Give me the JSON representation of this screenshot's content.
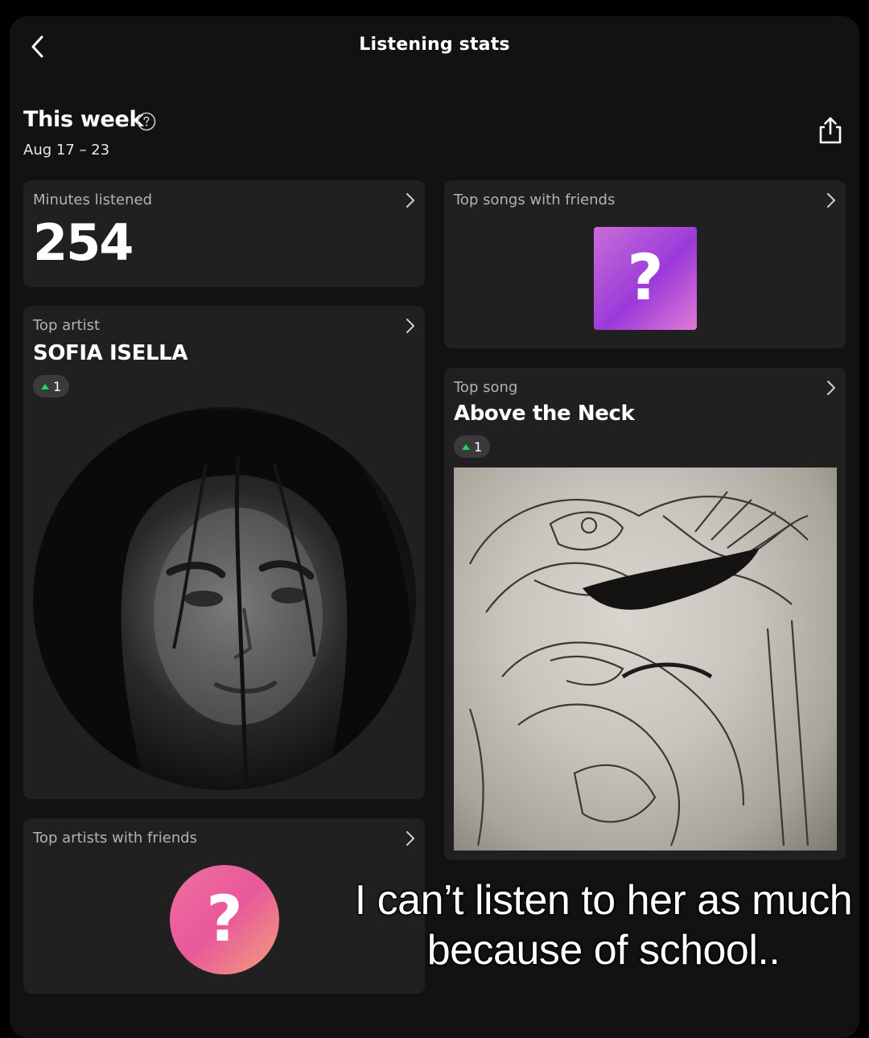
{
  "header": {
    "title": "Listening stats"
  },
  "period": {
    "title": "This week",
    "range": "Aug 17 – 23"
  },
  "minutes": {
    "label": "Minutes listened",
    "value": "254"
  },
  "top_artist": {
    "label": "Top artist",
    "name": "SOFIA ISELLA",
    "rank_change": "1"
  },
  "top_songs_friends": {
    "label": "Top songs with friends",
    "placeholder": "?"
  },
  "top_song": {
    "label": "Top song",
    "title": "Above the Neck",
    "rank_change": "1"
  },
  "top_artists_friends": {
    "label": "Top artists with friends",
    "placeholder": "?"
  },
  "caption": {
    "line1": "I can’t listen to her as much",
    "line2": "because of school.."
  },
  "colors": {
    "accent_up": "#1ed760",
    "background": "#121212",
    "card": "#202020"
  }
}
